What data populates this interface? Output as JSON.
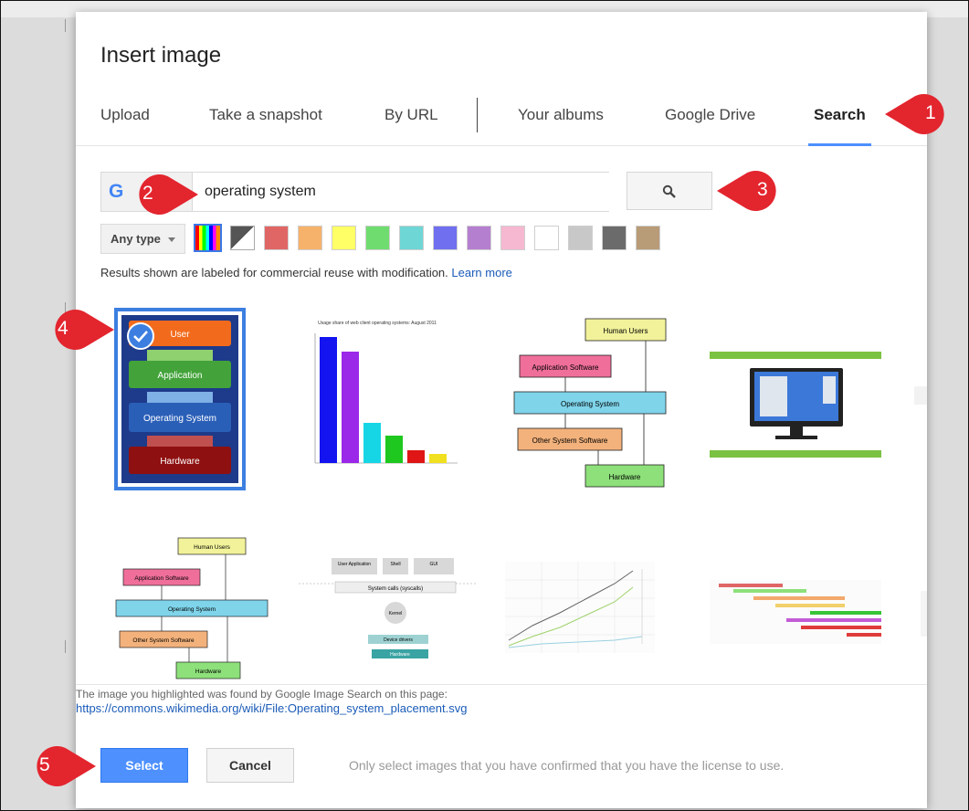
{
  "dialog": {
    "title": "Insert image",
    "tabs": [
      {
        "label": "Upload"
      },
      {
        "label": "Take a snapshot"
      },
      {
        "label": "By URL"
      },
      {
        "label": "Your albums"
      },
      {
        "label": "Google Drive"
      },
      {
        "label": "Search",
        "active": true
      }
    ],
    "search": {
      "value": "operating system",
      "logo_letter": "G"
    },
    "filters": {
      "type_label": "Any type",
      "colors": [
        "#e06666",
        "#f6b26b",
        "#ffff66",
        "#6fdc6f",
        "#6fd6d6",
        "#6f6ff0",
        "#b57fd0",
        "#f5b8d0",
        "#ffffff",
        "#c8c8c8",
        "#6b6b6b",
        "#b89b77"
      ]
    },
    "license_note": "Results shown are labeled for commercial reuse with modification.",
    "learn_more": "Learn more",
    "results": {
      "r1": {
        "user": "User",
        "application": "Application",
        "os": "Operating System",
        "hardware": "Hardware"
      },
      "r2": {
        "title": "Usage share of web client operating systems: August 2011"
      },
      "r3": {
        "human_users": "Human Users",
        "app_software": "Application Software",
        "os": "Operating System",
        "other_software": "Other System Software",
        "hardware": "Hardware"
      },
      "r5": {
        "human_users": "Human Users",
        "app_software": "Application Software",
        "os": "Operating System",
        "other_software": "Other System Software",
        "hardware": "Hardware"
      },
      "r6": {
        "user_app": "User Application",
        "shell": "Shell",
        "gui": "GUI",
        "syscall": "System calls (syscalls)",
        "kernel": "Kernel",
        "device_drivers": "Device drivers",
        "hardware": "Hardware"
      }
    },
    "source_note": "The image you highlighted was found by Google Image Search on this page:",
    "source_url": "https://commons.wikimedia.org/wiki/File:Operating_system_placement.svg",
    "select_label": "Select",
    "cancel_label": "Cancel",
    "license_warning": "Only select images that you have confirmed that you have the license to use."
  },
  "callouts": [
    "1",
    "2",
    "3",
    "4",
    "5"
  ],
  "colors": {
    "accent": "#4d90fe",
    "callout": "#e3252e"
  }
}
